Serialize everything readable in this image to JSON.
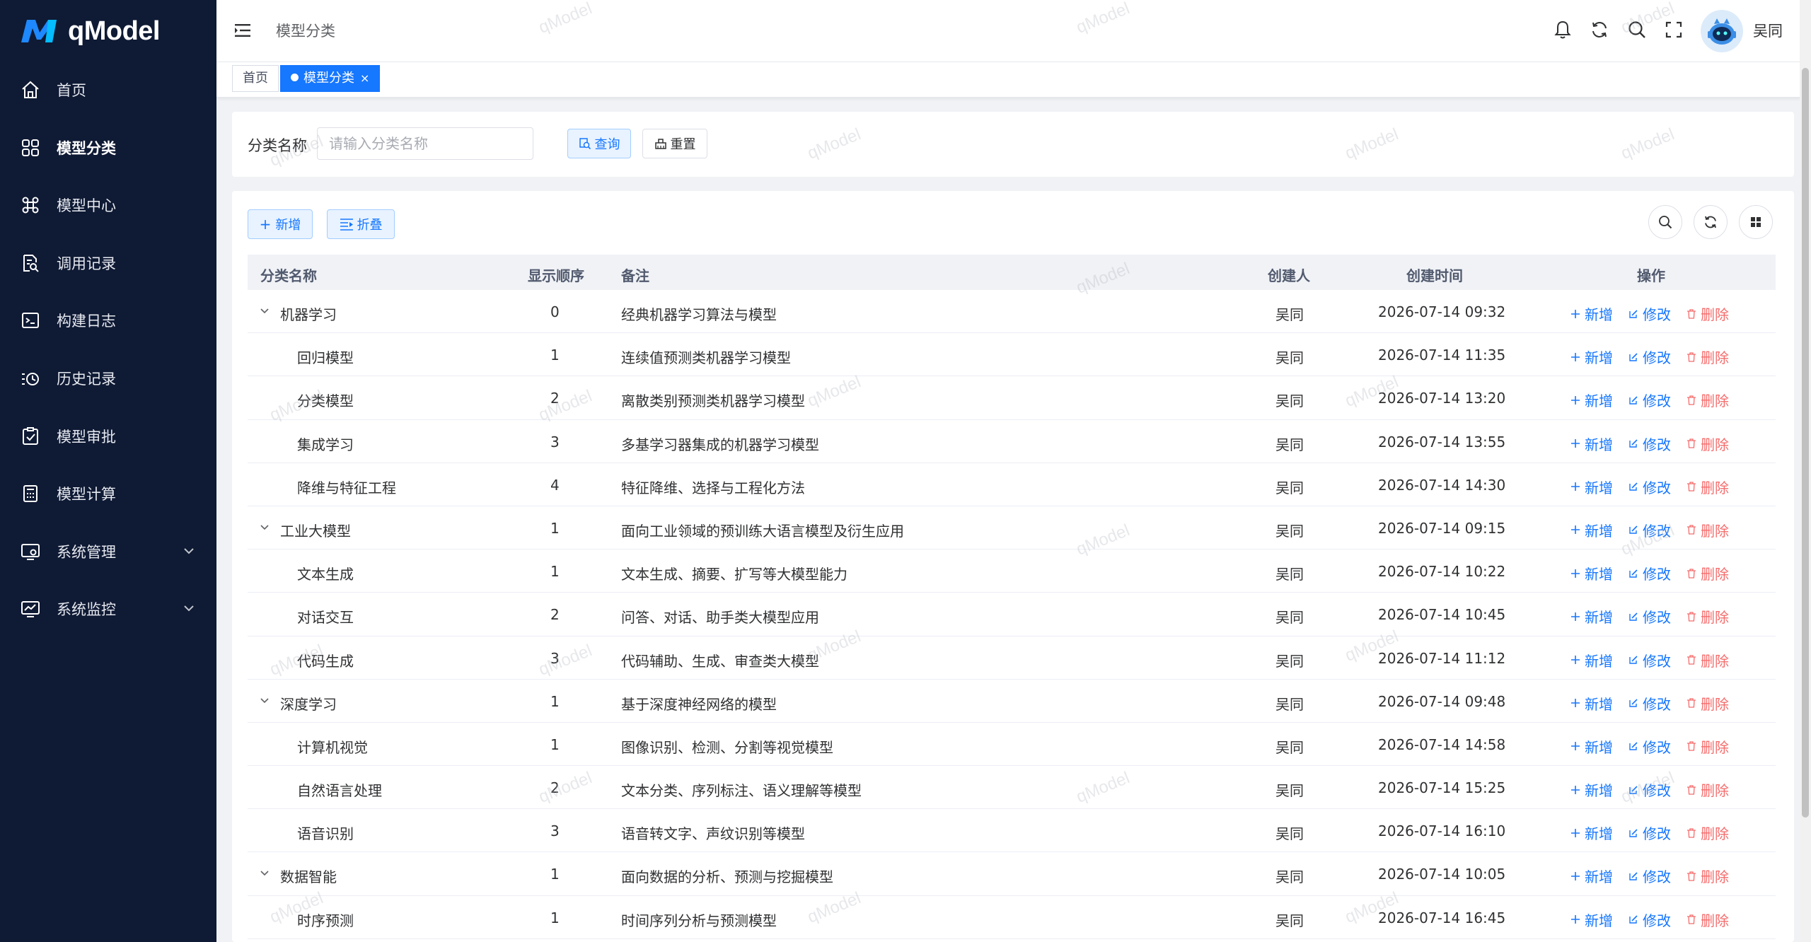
{
  "app": {
    "logo_text": "qModel",
    "username": "吴同"
  },
  "sidebar": {
    "items": [
      {
        "label": "首页",
        "icon": "home-icon"
      },
      {
        "label": "模型分类",
        "icon": "grid-icon",
        "active": true
      },
      {
        "label": "模型中心",
        "icon": "command-icon"
      },
      {
        "label": "调用记录",
        "icon": "document-search-icon"
      },
      {
        "label": "构建日志",
        "icon": "terminal-icon"
      },
      {
        "label": "历史记录",
        "icon": "history-icon"
      },
      {
        "label": "模型审批",
        "icon": "checklist-icon"
      },
      {
        "label": "模型计算",
        "icon": "calculator-icon"
      },
      {
        "label": "系统管理",
        "icon": "settings-monitor-icon",
        "expandable": true
      },
      {
        "label": "系统监控",
        "icon": "monitor-chart-icon",
        "expandable": true
      }
    ]
  },
  "header": {
    "title": "模型分类"
  },
  "tabs": [
    {
      "label": "首页",
      "active": false
    },
    {
      "label": "模型分类",
      "active": true
    }
  ],
  "search": {
    "label": "分类名称",
    "placeholder": "请输入分类名称",
    "query_label": "查询",
    "reset_label": "重置"
  },
  "toolbar": {
    "add_label": "新增",
    "fold_label": "折叠"
  },
  "table": {
    "columns": [
      "分类名称",
      "显示顺序",
      "备注",
      "创建人",
      "创建时间",
      "操作"
    ],
    "action_labels": {
      "add": "新增",
      "edit": "修改",
      "delete": "删除"
    },
    "rows": [
      {
        "name": "机器学习",
        "order": "0",
        "remark": "经典机器学习算法与模型",
        "creator": "吴同",
        "time": "2026-07-14 09:32",
        "level": 0
      },
      {
        "name": "回归模型",
        "order": "1",
        "remark": "连续值预测类机器学习模型",
        "creator": "吴同",
        "time": "2026-07-14 11:35",
        "level": 1
      },
      {
        "name": "分类模型",
        "order": "2",
        "remark": "离散类别预测类机器学习模型",
        "creator": "吴同",
        "time": "2026-07-14 13:20",
        "level": 1
      },
      {
        "name": "集成学习",
        "order": "3",
        "remark": "多基学习器集成的机器学习模型",
        "creator": "吴同",
        "time": "2026-07-14 13:55",
        "level": 1
      },
      {
        "name": "降维与特征工程",
        "order": "4",
        "remark": "特征降维、选择与工程化方法",
        "creator": "吴同",
        "time": "2026-07-14 14:30",
        "level": 1
      },
      {
        "name": "工业大模型",
        "order": "1",
        "remark": "面向工业领域的预训练大语言模型及衍生应用",
        "creator": "吴同",
        "time": "2026-07-14 09:15",
        "level": 0
      },
      {
        "name": "文本生成",
        "order": "1",
        "remark": "文本生成、摘要、扩写等大模型能力",
        "creator": "吴同",
        "time": "2026-07-14 10:22",
        "level": 1
      },
      {
        "name": "对话交互",
        "order": "2",
        "remark": "问答、对话、助手类大模型应用",
        "creator": "吴同",
        "time": "2026-07-14 10:45",
        "level": 1
      },
      {
        "name": "代码生成",
        "order": "3",
        "remark": "代码辅助、生成、审查类大模型",
        "creator": "吴同",
        "time": "2026-07-14 11:12",
        "level": 1
      },
      {
        "name": "深度学习",
        "order": "1",
        "remark": "基于深度神经网络的模型",
        "creator": "吴同",
        "time": "2026-07-14 09:48",
        "level": 0
      },
      {
        "name": "计算机视觉",
        "order": "1",
        "remark": "图像识别、检测、分割等视觉模型",
        "creator": "吴同",
        "time": "2026-07-14 14:58",
        "level": 1
      },
      {
        "name": "自然语言处理",
        "order": "2",
        "remark": "文本分类、序列标注、语义理解等模型",
        "creator": "吴同",
        "time": "2026-07-14 15:25",
        "level": 1
      },
      {
        "name": "语音识别",
        "order": "3",
        "remark": "语音转文字、声纹识别等模型",
        "creator": "吴同",
        "time": "2026-07-14 16:10",
        "level": 1
      },
      {
        "name": "数据智能",
        "order": "1",
        "remark": "面向数据的分析、预测与挖掘模型",
        "creator": "吴同",
        "time": "2026-07-14 10:05",
        "level": 0
      },
      {
        "name": "时序预测",
        "order": "1",
        "remark": "时间序列分析与预测模型",
        "creator": "吴同",
        "time": "2026-07-14 16:45",
        "level": 1
      }
    ]
  },
  "watermark": "qModel",
  "colors": {
    "sidebar_bg": "#0f1a34",
    "primary": "#1677ff",
    "danger": "#f56c6c"
  }
}
